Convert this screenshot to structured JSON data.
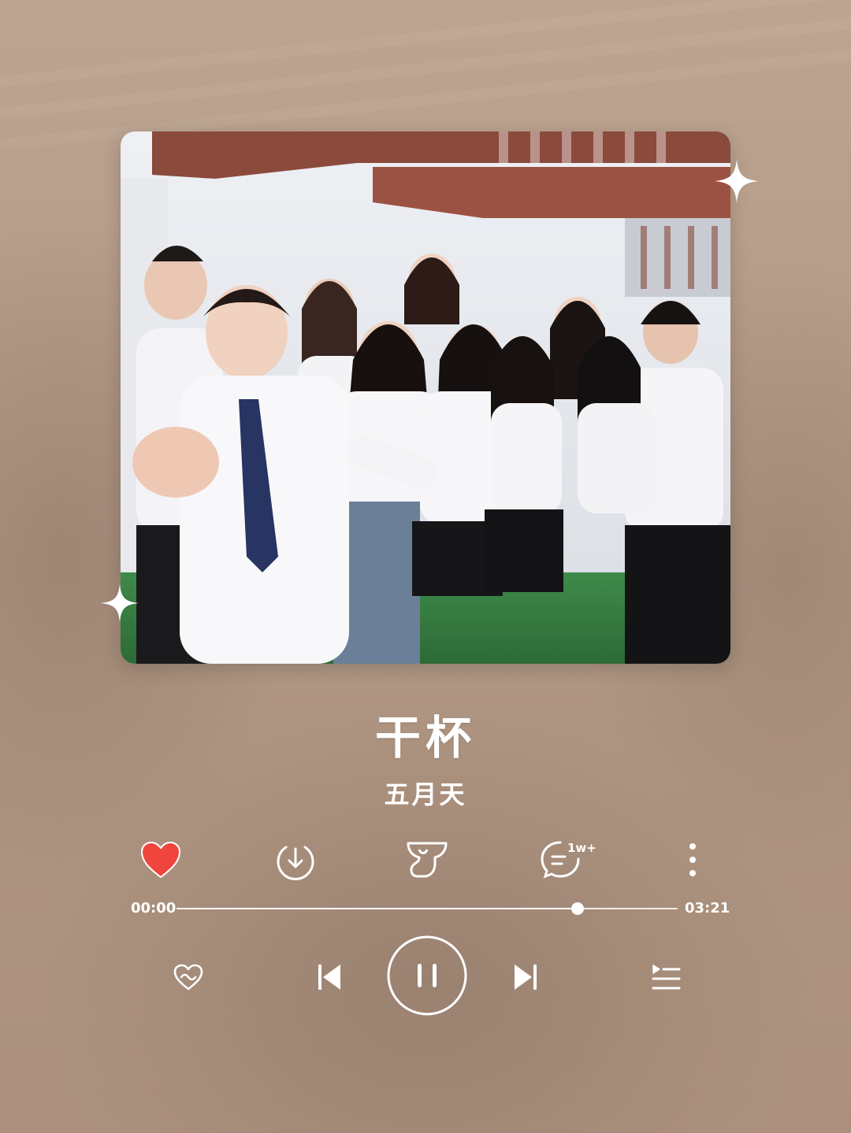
{
  "song": {
    "title": "干杯",
    "artist": "五月天"
  },
  "playback": {
    "current_time": "00:00",
    "duration": "03:21",
    "progress_fraction": 0.8,
    "state": "playing"
  },
  "actions": {
    "like_icon": "heart-filled-icon",
    "download_icon": "download-icon",
    "effect_icon": "sound-effect-icon",
    "comment_icon": "comment-icon",
    "comment_count": "1w+",
    "more_icon": "more-vertical-icon"
  },
  "controls": {
    "mode_icon": "heart-mode-icon",
    "prev_icon": "previous-icon",
    "play_icon": "pause-icon",
    "next_icon": "next-icon",
    "playlist_icon": "playlist-icon"
  },
  "colors": {
    "like_red": "#f0453c",
    "foreground": "#ffffff",
    "background": "#b49a88"
  }
}
